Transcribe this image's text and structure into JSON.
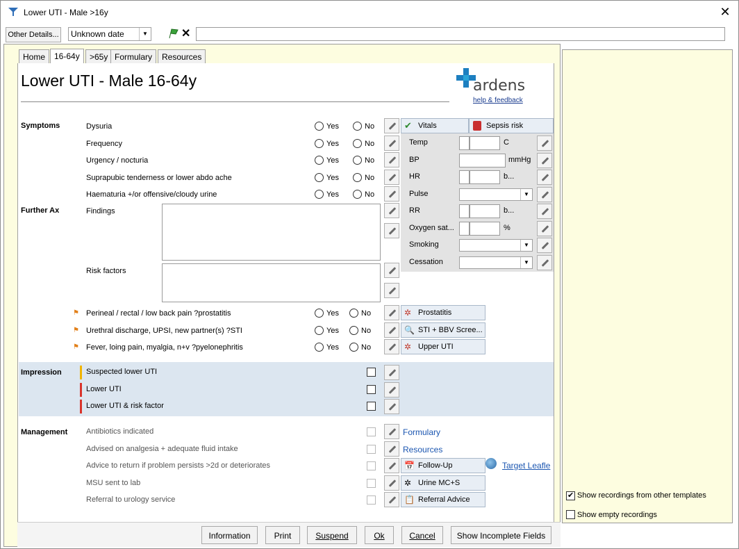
{
  "window": {
    "title": "Lower UTI - Male >16y"
  },
  "toolbar": {
    "other_details_label": "Other Details...",
    "date_value": "Unknown date"
  },
  "tabs": [
    {
      "label": "Home"
    },
    {
      "label": "16-64y"
    },
    {
      "label": ">65y"
    },
    {
      "label": "Formulary"
    },
    {
      "label": "Resources"
    }
  ],
  "page": {
    "title": "Lower UTI - Male 16-64y",
    "brand": "ardens",
    "help_link": "help & feedback"
  },
  "symptoms": {
    "section": "Symptoms",
    "items": [
      {
        "label": "Dysuria"
      },
      {
        "label": "Frequency"
      },
      {
        "label": "Urgency / nocturia"
      },
      {
        "label": "Suprapubic tenderness or lower abdo ache"
      },
      {
        "label": "Haematuria +/or offensive/cloudy urine"
      }
    ],
    "yes_label": "Yes",
    "no_label": "No"
  },
  "further_ax": {
    "section": "Further Ax",
    "findings_label": "Findings",
    "risk_factors_label": "Risk factors",
    "flagged": [
      {
        "label": "Perineal / rectal / low back pain ?prostatitis",
        "action": "Prostatitis"
      },
      {
        "label": "Urethral discharge, UPSI, new partner(s) ?STI",
        "action": "STI + BBV Scree..."
      },
      {
        "label": "Fever, loing pain, myalgia, n+v ?pyelonephritis",
        "action": "Upper UTI"
      }
    ]
  },
  "vitals": {
    "vitals_label": "Vitals",
    "sepsis_label": "Sepsis risk",
    "rows": [
      {
        "label": "Temp",
        "unit": "C"
      },
      {
        "label": "BP",
        "unit": "mmHg"
      },
      {
        "label": "HR",
        "unit": "b..."
      },
      {
        "label": "Pulse",
        "unit": ""
      },
      {
        "label": "RR",
        "unit": "b..."
      },
      {
        "label": "Oxygen sat...",
        "unit": "%"
      },
      {
        "label": "Smoking",
        "unit": ""
      },
      {
        "label": "Cessation",
        "unit": ""
      }
    ]
  },
  "impression": {
    "section": "Impression",
    "items": [
      {
        "label": "Suspected lower UTI",
        "color": "#f0b400"
      },
      {
        "label": "Lower UTI",
        "color": "#d9342b"
      },
      {
        "label": "Lower UTI & risk factor",
        "color": "#d9342b"
      }
    ]
  },
  "management": {
    "section": "Management",
    "items": [
      {
        "label": "Antibiotics indicated",
        "action": "Formulary"
      },
      {
        "label": "Advised on analgesia + adequate fluid intake",
        "action": "Resources"
      },
      {
        "label": "Advice to return if problem persists >2d or deteriorates",
        "action": "Follow-Up"
      },
      {
        "label": "MSU sent to lab",
        "action": "Urine MC+S"
      },
      {
        "label": "Referral to urology service",
        "action": "Referral Advice"
      }
    ],
    "target_link": "Target Leafle"
  },
  "side_panel": {
    "show_other_templates": "Show recordings from other templates",
    "show_other_templates_checked": true,
    "show_empty": "Show empty recordings",
    "show_empty_checked": false
  },
  "footer": {
    "information": "Information",
    "print": "Print",
    "suspend": "Suspend",
    "ok": "Ok",
    "cancel": "Cancel",
    "show_incomplete": "Show Incomplete Fields"
  }
}
